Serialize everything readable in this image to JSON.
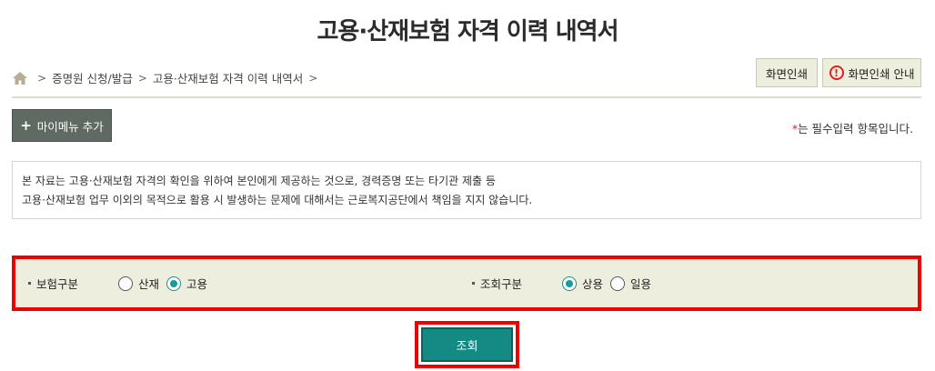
{
  "page": {
    "title": "고용·산재보험 자격 이력 내역서"
  },
  "breadcrumb": {
    "items": [
      "증명원 신청/발급",
      "고용·산재보험 자격 이력 내역서"
    ],
    "separator": ">"
  },
  "toolbar": {
    "print_label": "화면인쇄",
    "print_guide_label": "화면인쇄 안내",
    "warn_glyph": "!"
  },
  "mymenu": {
    "label": "마이메뉴 추가",
    "plus": "+"
  },
  "required_note": {
    "star": "*",
    "text": "는 필수입력 항목입니다."
  },
  "notice": {
    "line1": "본 자료는 고용·산재보험 자격의 확인을 위하여 본인에게 제공하는 것으로, 경력증명 또는 타기관 제출 등",
    "line2": "고용·산재보험 업무 이외의 목적으로 활용 시 발생하는 문제에 대해서는 근로복지공단에서 책임을 지지 않습니다."
  },
  "search": {
    "insurance_type": {
      "label": "보험구분",
      "options": [
        {
          "label": "산재",
          "checked": false
        },
        {
          "label": "고용",
          "checked": true
        }
      ]
    },
    "inquiry_type": {
      "label": "조회구분",
      "options": [
        {
          "label": "상용",
          "checked": true
        },
        {
          "label": "일용",
          "checked": false
        }
      ]
    },
    "submit_label": "조회"
  },
  "colors": {
    "accent": "#148a84",
    "highlight": "#ee0000",
    "panel": "#eeeedf"
  },
  "icons": {
    "home": "home-icon",
    "warning": "warning-icon"
  }
}
